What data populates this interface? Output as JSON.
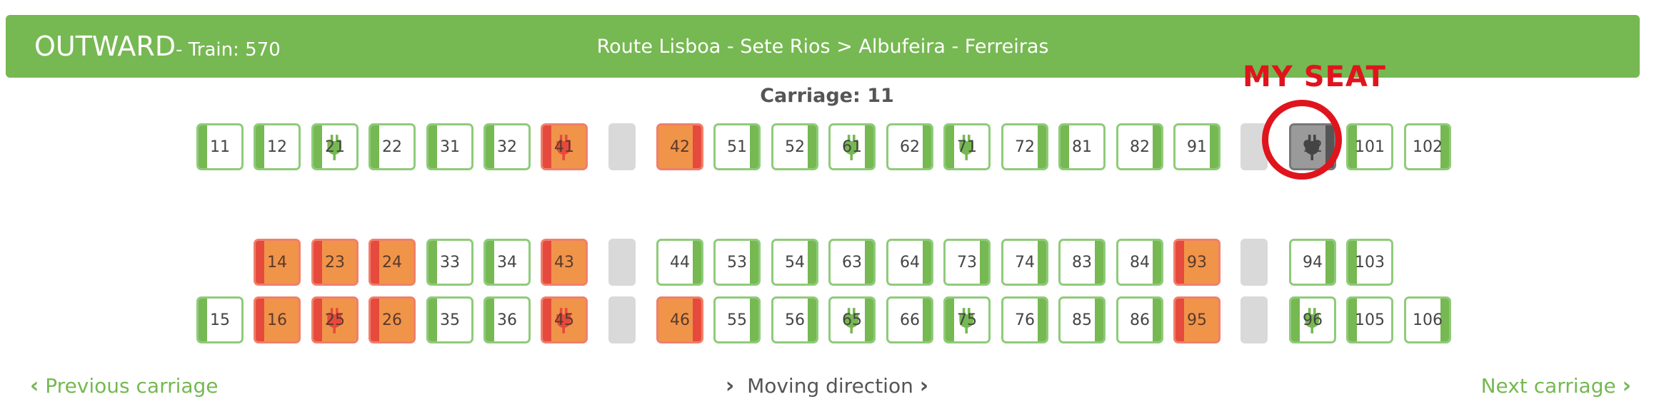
{
  "header": {
    "direction": "OUTWARD",
    "train": "- Train: 570",
    "route": "Route Lisboa - Sete Rios > Albufeira - Ferreiras"
  },
  "carriage_title": "Carriage: 11",
  "annotation": {
    "label": "MY SEAT"
  },
  "legend_colors": {
    "available": "#76b852",
    "occupied": "#f0944a",
    "occupied_side": "#e64a3d",
    "selected": "#9a9a9a"
  },
  "rows": {
    "top": [
      {
        "n": "11",
        "status": "available",
        "side": "left",
        "plug": false
      },
      {
        "n": "12",
        "status": "available",
        "side": "left",
        "plug": false
      },
      {
        "n": "21",
        "status": "available",
        "side": "left",
        "plug": true
      },
      {
        "n": "22",
        "status": "available",
        "side": "left",
        "plug": false
      },
      {
        "n": "31",
        "status": "available",
        "side": "left",
        "plug": false
      },
      {
        "n": "32",
        "status": "available",
        "side": "left",
        "plug": false
      },
      {
        "n": "41",
        "status": "occupied",
        "side": "left",
        "plug": true
      },
      {
        "gap": true
      },
      {
        "n": "42",
        "status": "occupied",
        "side": "right",
        "plug": false
      },
      {
        "n": "51",
        "status": "available",
        "side": "right",
        "plug": false
      },
      {
        "n": "52",
        "status": "available",
        "side": "right",
        "plug": false
      },
      {
        "n": "61",
        "status": "available",
        "side": "right",
        "plug": true
      },
      {
        "n": "62",
        "status": "available",
        "side": "right",
        "plug": false
      },
      {
        "n": "71",
        "status": "available",
        "side": "left",
        "plug": true
      },
      {
        "n": "72",
        "status": "available",
        "side": "right",
        "plug": false
      },
      {
        "n": "81",
        "status": "available",
        "side": "left",
        "plug": false
      },
      {
        "n": "82",
        "status": "available",
        "side": "right",
        "plug": false
      },
      {
        "n": "91",
        "status": "available",
        "side": "right",
        "plug": false
      },
      {
        "gap": true
      },
      {
        "n": "92",
        "status": "selected",
        "side": "right",
        "plug": true
      },
      {
        "n": "101",
        "status": "available",
        "side": "left",
        "plug": false
      },
      {
        "n": "102",
        "status": "available",
        "side": "right",
        "plug": false
      }
    ],
    "middle": [
      {
        "empty": true
      },
      {
        "n": "14",
        "status": "occupied",
        "side": "left",
        "plug": false
      },
      {
        "n": "23",
        "status": "occupied",
        "side": "left",
        "plug": false
      },
      {
        "n": "24",
        "status": "occupied",
        "side": "left",
        "plug": false
      },
      {
        "n": "33",
        "status": "available",
        "side": "left",
        "plug": false
      },
      {
        "n": "34",
        "status": "available",
        "side": "left",
        "plug": false
      },
      {
        "n": "43",
        "status": "occupied",
        "side": "left",
        "plug": false
      },
      {
        "gap": true
      },
      {
        "n": "44",
        "status": "available",
        "side": "right",
        "plug": false
      },
      {
        "n": "53",
        "status": "available",
        "side": "right",
        "plug": false
      },
      {
        "n": "54",
        "status": "available",
        "side": "right",
        "plug": false
      },
      {
        "n": "63",
        "status": "available",
        "side": "right",
        "plug": false
      },
      {
        "n": "64",
        "status": "available",
        "side": "right",
        "plug": false
      },
      {
        "n": "73",
        "status": "available",
        "side": "right",
        "plug": false
      },
      {
        "n": "74",
        "status": "available",
        "side": "right",
        "plug": false
      },
      {
        "n": "83",
        "status": "available",
        "side": "right",
        "plug": false
      },
      {
        "n": "84",
        "status": "available",
        "side": "right",
        "plug": false
      },
      {
        "n": "93",
        "status": "occupied",
        "side": "left",
        "plug": false
      },
      {
        "gap": true
      },
      {
        "n": "94",
        "status": "available",
        "side": "right",
        "plug": false
      },
      {
        "n": "103",
        "status": "available",
        "side": "left",
        "plug": false
      }
    ],
    "bottom": [
      {
        "n": "15",
        "status": "available",
        "side": "left",
        "plug": false
      },
      {
        "n": "16",
        "status": "occupied",
        "side": "left",
        "plug": false
      },
      {
        "n": "25",
        "status": "occupied",
        "side": "left",
        "plug": true
      },
      {
        "n": "26",
        "status": "occupied",
        "side": "left",
        "plug": false
      },
      {
        "n": "35",
        "status": "available",
        "side": "left",
        "plug": false
      },
      {
        "n": "36",
        "status": "available",
        "side": "left",
        "plug": false
      },
      {
        "n": "45",
        "status": "occupied",
        "side": "left",
        "plug": true
      },
      {
        "gap": true
      },
      {
        "n": "46",
        "status": "occupied",
        "side": "right",
        "plug": false
      },
      {
        "n": "55",
        "status": "available",
        "side": "right",
        "plug": false
      },
      {
        "n": "56",
        "status": "available",
        "side": "right",
        "plug": false
      },
      {
        "n": "65",
        "status": "available",
        "side": "right",
        "plug": true
      },
      {
        "n": "66",
        "status": "available",
        "side": "right",
        "plug": false
      },
      {
        "n": "75",
        "status": "available",
        "side": "left",
        "plug": true
      },
      {
        "n": "76",
        "status": "available",
        "side": "right",
        "plug": false
      },
      {
        "n": "85",
        "status": "available",
        "side": "right",
        "plug": false
      },
      {
        "n": "86",
        "status": "available",
        "side": "right",
        "plug": false
      },
      {
        "n": "95",
        "status": "occupied",
        "side": "left",
        "plug": false
      },
      {
        "gap": true
      },
      {
        "n": "96",
        "status": "available",
        "side": "left",
        "plug": true
      },
      {
        "n": "105",
        "status": "available",
        "side": "left",
        "plug": false
      },
      {
        "n": "106",
        "status": "available",
        "side": "right",
        "plug": false
      }
    ]
  },
  "nav": {
    "prev": "Previous carriage",
    "direction": "Moving direction",
    "next": "Next carriage"
  }
}
